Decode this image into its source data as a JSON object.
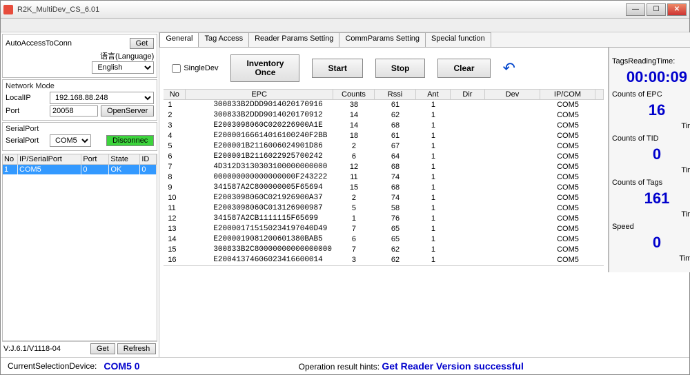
{
  "window": {
    "title": "R2K_MultiDev_CS_6.01"
  },
  "left": {
    "autoAccess": "AutoAccessToConn",
    "getBtn": "Get",
    "langLabel": "语言(Language)",
    "langValue": "English",
    "networkMode": "Network Mode",
    "localIpLabel": "LocalIP",
    "localIpValue": "192.168.88.248",
    "portLabel": "Port",
    "portValue": "20058",
    "openServer": "OpenServer",
    "serialPortTitle": "SerialPort",
    "serialPortLabel": "SerialPort",
    "serialPortValue": "COM5",
    "disconnect": "Disconnec",
    "connTable": {
      "headers": [
        "No",
        "IP/SerialPort",
        "Port",
        "State",
        "ID"
      ],
      "row": [
        "1",
        "COM5",
        "0",
        "OK",
        "0"
      ]
    },
    "version": "V:J.6.1/V1118-04",
    "getBtn2": "Get",
    "refreshBtn": "Refresh"
  },
  "tabs": [
    "General",
    "Tag Access",
    "Reader Params Setting",
    "CommParams Setting",
    "Special function"
  ],
  "toolbar": {
    "singleDev": "SingleDev",
    "inventoryOnce": "Inventory\nOnce",
    "start": "Start",
    "stop": "Stop",
    "clear": "Clear"
  },
  "table": {
    "headers": [
      "No",
      "EPC",
      "Counts",
      "Rssi",
      "Ant",
      "Dir",
      "Dev",
      "IP/COM"
    ],
    "rows": [
      [
        "1",
        "300833B2DDD9014020170916",
        "38",
        "61",
        "1",
        "",
        "",
        "COM5"
      ],
      [
        "2",
        "300833B2DDD9014020170912",
        "14",
        "62",
        "1",
        "",
        "",
        "COM5"
      ],
      [
        "3",
        "E2003098060C020226900A1E",
        "14",
        "68",
        "1",
        "",
        "",
        "COM5"
      ],
      [
        "4",
        "E20000166614016100240F2BB",
        "18",
        "61",
        "1",
        "",
        "",
        "COM5"
      ],
      [
        "5",
        "E200001B2116006024901D86",
        "2",
        "67",
        "1",
        "",
        "",
        "COM5"
      ],
      [
        "6",
        "E200001B2116022925700242",
        "6",
        "64",
        "1",
        "",
        "",
        "COM5"
      ],
      [
        "7",
        "4D312D3130303100000000000",
        "12",
        "68",
        "1",
        "",
        "",
        "COM5"
      ],
      [
        "8",
        "000000000000000000F243222",
        "11",
        "74",
        "1",
        "",
        "",
        "COM5"
      ],
      [
        "9",
        "341587A2C800000005F65694",
        "15",
        "68",
        "1",
        "",
        "",
        "COM5"
      ],
      [
        "10",
        "E2003098060C021926900A37",
        "2",
        "74",
        "1",
        "",
        "",
        "COM5"
      ],
      [
        "11",
        "E2003098060C013126900987",
        "5",
        "58",
        "1",
        "",
        "",
        "COM5"
      ],
      [
        "12",
        "341587A2CB1111115F65699",
        "1",
        "76",
        "1",
        "",
        "",
        "COM5"
      ],
      [
        "13",
        "E200001715150234197040D49",
        "7",
        "65",
        "1",
        "",
        "",
        "COM5"
      ],
      [
        "14",
        "E2000019081200601380BAB5",
        "6",
        "65",
        "1",
        "",
        "",
        "COM5"
      ],
      [
        "15",
        "300833B2C80000000000000000",
        "7",
        "62",
        "1",
        "",
        "",
        "COM5"
      ],
      [
        "16",
        "E20041374606023416600014",
        "3",
        "62",
        "1",
        "",
        "",
        "COM5"
      ]
    ]
  },
  "stats": {
    "tagsReadingTime": "TagsReadingTime:",
    "time": "00:00:09",
    "countsEpc": "Counts of EPC",
    "epc": "16",
    "countsTid": "Counts of TID",
    "tid": "0",
    "countsTags": "Counts of Tags",
    "tags": "161",
    "speed": "Speed",
    "speedVal": "0",
    "times": "Times",
    "timesDot": "Times."
  },
  "status": {
    "currentLabel": "CurrentSelectionDevice:",
    "currentValue": "COM5  0",
    "hintLabel": "Operation result hints:",
    "hintValue": "Get Reader Version successful"
  }
}
